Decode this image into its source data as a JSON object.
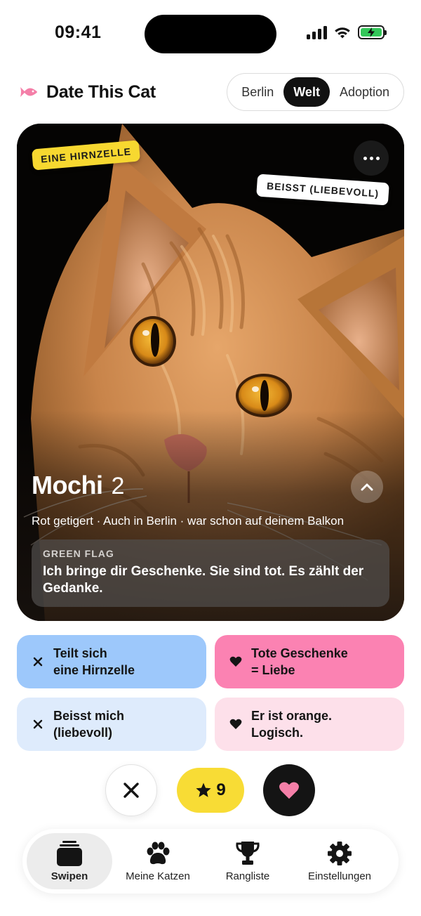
{
  "status_bar": {
    "time": "09:41",
    "icons": [
      "cellular-signal-icon",
      "wifi-icon",
      "battery-charging-icon"
    ],
    "battery_color": "#32c759"
  },
  "header": {
    "title": "Date This Cat",
    "logo_icon": "fish-icon",
    "logo_color": "#f47fa8",
    "segments": [
      {
        "label": "Berlin",
        "active": false
      },
      {
        "label": "Welt",
        "active": true
      },
      {
        "label": "Adoption",
        "active": false
      }
    ]
  },
  "card": {
    "stickers": [
      "EINE HIRNZELLE",
      "BEISST (LIEBEVOLL)"
    ],
    "name": "Mochi",
    "age": "2",
    "meta": "Rot getigert · Auch in Berlin · war schon auf deinem Balkon",
    "green_flag": {
      "label": "GREEN FLAG",
      "text": "Ich bringe dir Geschenke. Sie sind tot. Es zählt der Gedanke."
    }
  },
  "chips": [
    {
      "text": "Teilt sich\neine Hirnzelle",
      "icon": "x-icon",
      "color": "#9dc8fb"
    },
    {
      "text": "Tote Geschenke\n= Liebe",
      "icon": "heart-icon",
      "color": "#fb82b2"
    },
    {
      "text": "Beisst mich\n(liebevoll)",
      "icon": "x-icon",
      "color": "#deebfc"
    },
    {
      "text": "Er ist orange.\nLogisch.",
      "icon": "heart-icon",
      "color": "#fde0ea"
    }
  ],
  "actions": {
    "super_count": "9",
    "like_color": "#f47fa8",
    "super_color": "#f8dc35"
  },
  "tabs": [
    {
      "label": "Swipen",
      "icon": "cards-stack-icon",
      "active": true
    },
    {
      "label": "Meine Katzen",
      "icon": "paw-icon",
      "active": false
    },
    {
      "label": "Rangliste",
      "icon": "trophy-icon",
      "active": false
    },
    {
      "label": "Einstellungen",
      "icon": "gear-icon",
      "active": false
    }
  ]
}
